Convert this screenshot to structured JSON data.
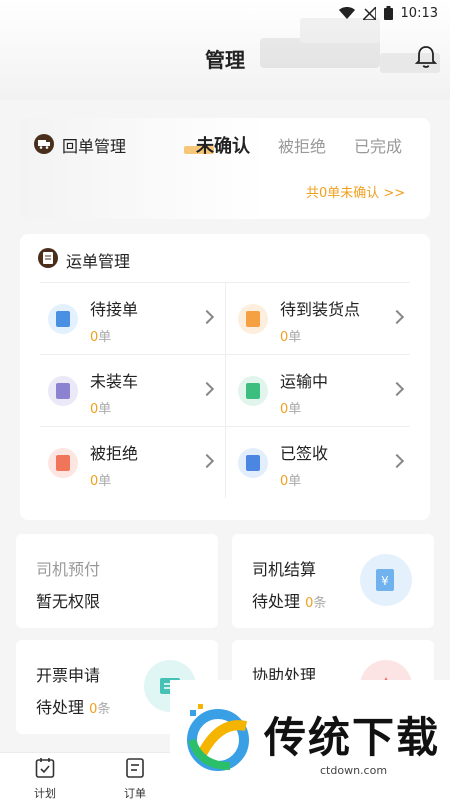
{
  "status_bar": {
    "time": "10:13"
  },
  "header": {
    "title": "管理"
  },
  "receipt_management": {
    "title": "回单管理",
    "tabs": [
      {
        "label": "未确认",
        "active": true
      },
      {
        "label": "被拒绝",
        "active": false
      },
      {
        "label": "已完成",
        "active": false
      }
    ],
    "summary_link": "共0单未确认 >>"
  },
  "waybill_management": {
    "title": "运单管理",
    "unit": "单",
    "items": [
      {
        "label": "待接单",
        "count": "0",
        "icon": "clipboard-icon",
        "icon_bg": "#e3f0fd",
        "icon_color": "#4a90e2"
      },
      {
        "label": "待到装货点",
        "count": "0",
        "icon": "location-clipboard-icon",
        "icon_bg": "#fdeedd",
        "icon_color": "#f5a142"
      },
      {
        "label": "未装车",
        "count": "0",
        "icon": "box-icon",
        "icon_bg": "#ebe8f7",
        "icon_color": "#8c82d0"
      },
      {
        "label": "运输中",
        "count": "0",
        "icon": "truck-icon",
        "icon_bg": "#e2f5ec",
        "icon_color": "#3cbf7e"
      },
      {
        "label": "被拒绝",
        "count": "0",
        "icon": "reject-icon",
        "icon_bg": "#fde6e2",
        "icon_color": "#f0755a"
      },
      {
        "label": "已签收",
        "count": "0",
        "icon": "checked-icon",
        "icon_bg": "#e3eefc",
        "icon_color": "#4a86e2"
      }
    ]
  },
  "driver_prepay": {
    "title": "司机预付",
    "status": "暂无权限"
  },
  "driver_settlement": {
    "title": "司机结算",
    "status": "待处理",
    "count": "0",
    "unit": "条",
    "icon": "yuan-document-icon",
    "icon_bg": "#e4f1fd"
  },
  "invoice_request": {
    "title": "开票申请",
    "status": "待处理",
    "count": "0",
    "unit": "条",
    "icon": "invoice-icon",
    "icon_bg": "#dff6f4"
  },
  "assist_handling": {
    "title": "协助处理",
    "icon": "assist-icon",
    "icon_bg": "#fde4e4"
  },
  "bottom_nav": [
    {
      "label": "计划",
      "icon": "calendar-check-icon"
    },
    {
      "label": "订单",
      "icon": "order-icon"
    }
  ],
  "watermark": {
    "text": "传统下载",
    "url": "ctdown.com"
  },
  "colors": {
    "accent": "#f0a020",
    "brand_dark": "#4a2e1c"
  }
}
